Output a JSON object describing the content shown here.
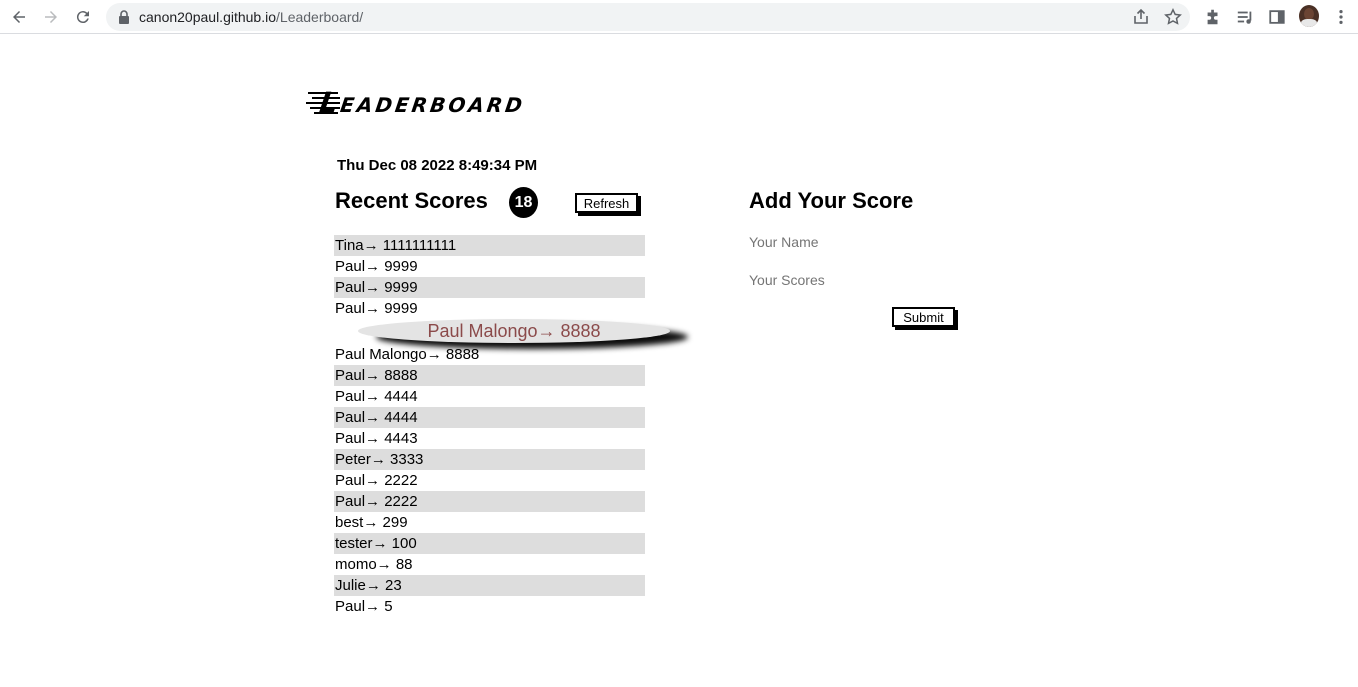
{
  "browser": {
    "url_host": "canon20paul.github.io",
    "url_path": "/Leaderboard/"
  },
  "page": {
    "title": "Leaderboard",
    "datetime": "Thu Dec 08 2022 8:49:34 PM",
    "recent": {
      "heading": "Recent Scores",
      "count": "18",
      "refresh_label": "Refresh",
      "hover_entry": "Paul Malongo→ 8888",
      "scores": [
        "Tina→ 1111111111",
        "Paul→ 9999",
        "Paul→ 9999",
        "Paul→ 9999",
        "",
        "Paul Malongo→ 8888",
        "Paul→ 8888",
        "Paul→ 4444",
        "Paul→ 4444",
        "Paul→ 4443",
        "Peter→ 3333",
        "Paul→ 2222",
        "Paul→ 2222",
        "best→ 299",
        "tester→ 100",
        "momo→ 88",
        "Julie→ 23",
        "Paul→ 5"
      ]
    },
    "add": {
      "heading": "Add Your Score",
      "name_placeholder": "Your Name",
      "score_placeholder": "Your Scores",
      "submit_label": "Submit"
    }
  }
}
